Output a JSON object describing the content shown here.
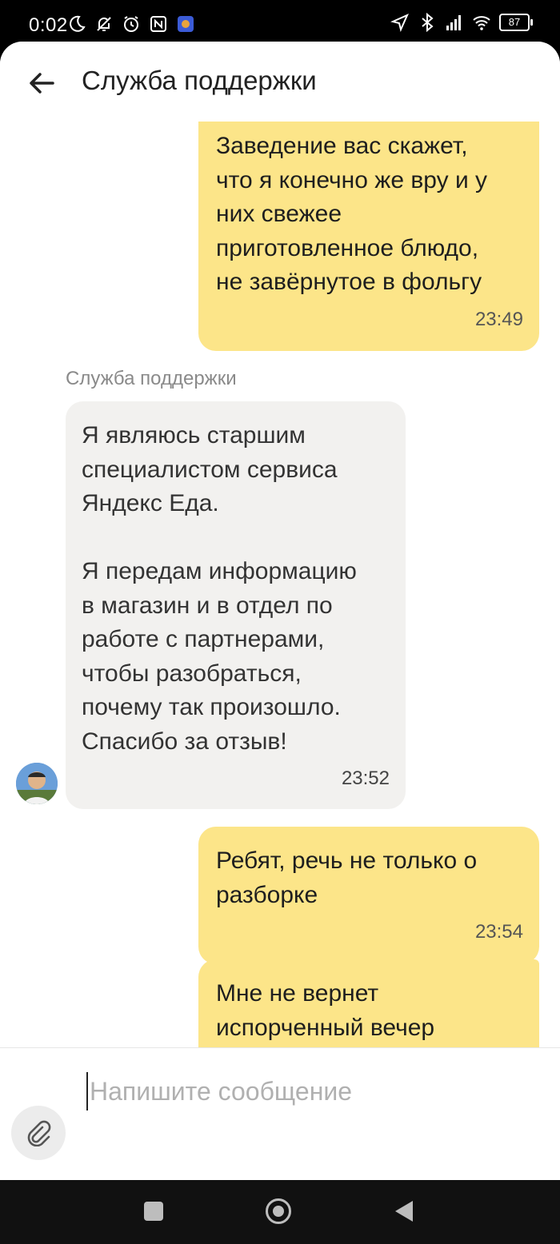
{
  "status_bar": {
    "time": "0:02",
    "battery": "87",
    "left_icons": [
      "moon-icon",
      "bell-off-icon",
      "alarm-icon",
      "nfc-icon",
      "app-icon"
    ],
    "right_icons": [
      "location-icon",
      "bluetooth-icon",
      "signal-icon",
      "wifi-icon",
      "battery-icon"
    ]
  },
  "header": {
    "title": "Служба поддержки"
  },
  "messages": [
    {
      "direction": "out",
      "text": "Заведение вас скажет,\nчто я конечно же вру и у\nних свежее\nприготовленное блюдо,\nне завёрнутое в фольгу",
      "time": "23:49"
    },
    {
      "direction": "in",
      "sender": "Служба поддержки",
      "text": "Я являюсь старшим\nспециалистом сервиса\nЯндекс Еда.\n\nЯ передам информацию\nв магазин и в отдел по\nработе с партнерами,\nчтобы разобраться,\nпочему так произошло.\nСпасибо за отзыв!",
      "time": "23:52"
    },
    {
      "direction": "out",
      "text": "Ребят, речь не только о\nразборке",
      "time": "23:54"
    },
    {
      "direction": "out",
      "text": "Мне не вернет\nиспорченный вечер",
      "time": ""
    }
  ],
  "composer": {
    "placeholder": "Напишите сообщение",
    "value": ""
  },
  "colors": {
    "outgoing_bubble": "#fce589",
    "incoming_bubble": "#f2f1ef"
  }
}
